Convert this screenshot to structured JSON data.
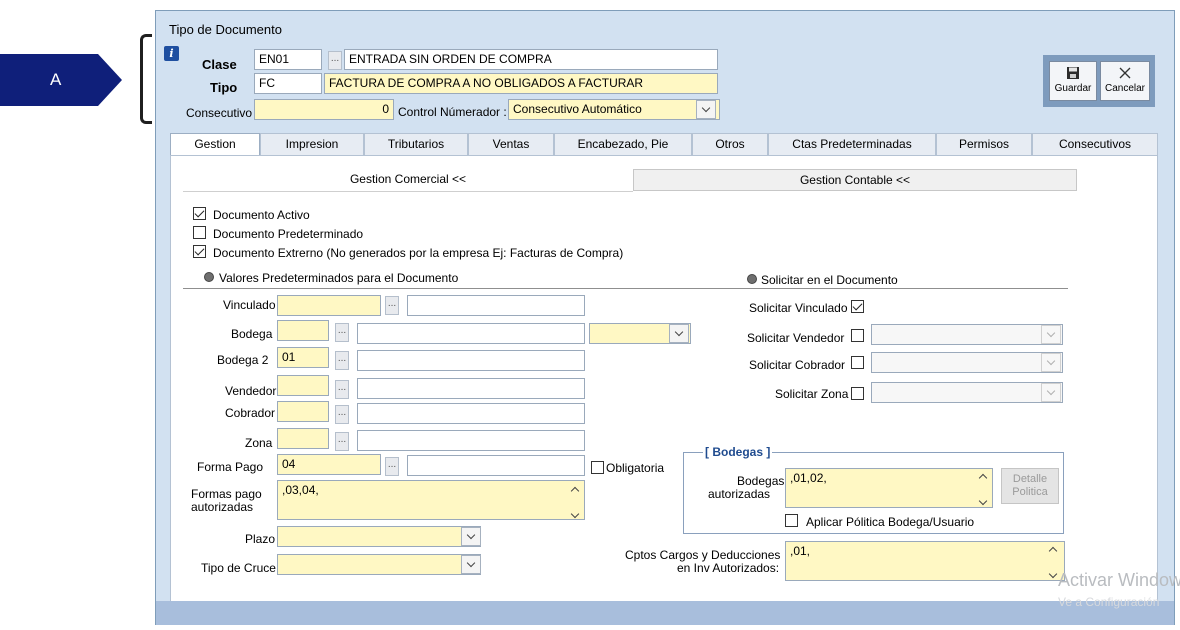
{
  "annotation": {
    "label": "A",
    "color": "#0f1f7a"
  },
  "window": {
    "title": "Tipo de Documento"
  },
  "header": {
    "clase_label": "Clase",
    "clase_code": "EN01",
    "clase_desc": "ENTRADA SIN ORDEN DE COMPRA",
    "tipo_label": "Tipo",
    "tipo_code": "FC",
    "tipo_desc": "FACTURA DE COMPRA A NO OBLIGADOS A FACTURAR",
    "consecutivo_label": "Consecutivo",
    "consecutivo_value": "0",
    "control_label": "Control Númerador :",
    "control_value": "Consecutivo Automático",
    "ellipsis": "...",
    "info_icon": "i"
  },
  "toolbar": {
    "save_label": "Guardar",
    "cancel_label": "Cancelar"
  },
  "tabs": [
    {
      "label": "Gestion"
    },
    {
      "label": "Impresion"
    },
    {
      "label": "Tributarios"
    },
    {
      "label": "Ventas"
    },
    {
      "label": "Encabezado, Pie"
    },
    {
      "label": "Otros"
    },
    {
      "label": "Ctas Predeterminadas"
    },
    {
      "label": "Permisos"
    },
    {
      "label": "Consecutivos"
    }
  ],
  "subtabs": {
    "comercial": "Gestion Comercial <<",
    "contable": "Gestion Contable <<"
  },
  "checks": {
    "activo": "Documento Activo",
    "predeterminado": "Documento Predeterminado",
    "externo": "Documento Extrerno (No generados por la empresa  Ej: Facturas de Compra)"
  },
  "sections": {
    "valores": "Valores Predeterminados para el Documento",
    "solicitar": "Solicitar en el Documento"
  },
  "form": {
    "vinculado": "Vinculado",
    "bodega": "Bodega",
    "bodega2": "Bodega 2",
    "bodega2_value": "01",
    "vendedor": "Vendedor",
    "cobrador": "Cobrador",
    "zona": "Zona",
    "forma_pago": "Forma Pago",
    "forma_pago_value": "04",
    "obligatoria": "Obligatoria",
    "formas_autorizadas_1": "Formas pago",
    "formas_autorizadas_2": "autorizadas",
    "formas_autorizadas_value": ",03,04,",
    "plazo": "Plazo",
    "tipo_cruce": "Tipo de Cruce"
  },
  "solicitar": {
    "vinculado": "Solicitar Vinculado",
    "vendedor": "Solicitar Vendedor",
    "cobrador": "Solicitar Cobrador",
    "zona": "Solicitar Zona"
  },
  "bodegas": {
    "title": "[ Bodegas ]",
    "label_1": "Bodegas",
    "label_2": "autorizadas",
    "value": ",01,02,",
    "detalle_1": "Detalle",
    "detalle_2": "Politica",
    "aplicar": "Aplicar Pólitica Bodega/Usuario"
  },
  "cptos": {
    "label_1": "Cptos Cargos y Deducciones",
    "label_2": "en Inv Autorizados:",
    "value": ",01,"
  },
  "watermark": {
    "line1": "Activar Windows",
    "line2": "Ve a Configuración"
  }
}
